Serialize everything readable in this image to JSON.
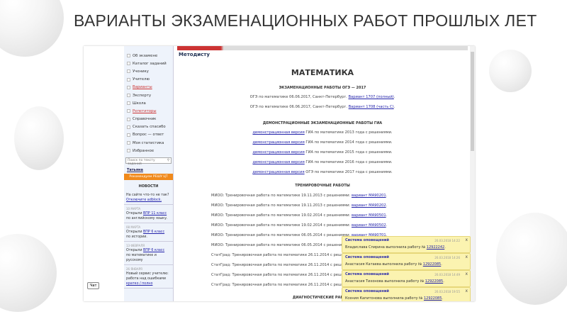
{
  "slide_title": "ВАРИАНТЫ ЭКЗАМЕНАЦИОННЫХ РАБОТ ПРОШЛЫХ ЛЕТ",
  "menu": [
    {
      "label": "Об экзамене"
    },
    {
      "label": "Каталог заданий"
    },
    {
      "label": "Ученику"
    },
    {
      "label": "Учителю"
    },
    {
      "label": "Варианты",
      "red": true
    },
    {
      "label": "Эксперту"
    },
    {
      "label": "Школа"
    },
    {
      "label": "Репетиторы",
      "red": true
    },
    {
      "label": "Справочник"
    },
    {
      "label": "Сказать спасибо"
    },
    {
      "label": "Вопрос — ответ"
    },
    {
      "label": "Моя статистика"
    },
    {
      "label": "Избранное"
    }
  ],
  "search_placeholder": "Поиск по тексту заданий",
  "user": "Татьяна",
  "recommend": "Рекомендуем РЕШУ ЦТ",
  "news": {
    "title": "НОВОСТИ",
    "items": [
      {
        "date": "",
        "text": "На сайте что-то не так?",
        "link": "Отключите adblock.",
        "rest": ""
      },
      {
        "date": "10 МАРТА",
        "text": "Открыли",
        "link": "ВПР 11 класс",
        "rest": "по английскому языку."
      },
      {
        "date": "08 МАРТА",
        "text": "Открыли",
        "link": "ВПР 6 класс",
        "rest": "по истории."
      },
      {
        "date": "13 ФЕВРАЛЯ",
        "text": "Открыли",
        "link": "ВПР 6 класс",
        "rest": "по математике и русскому"
      },
      {
        "date": "26 ЯНВАРЯ",
        "text": "Новый сервис учителю: работа над ошибками",
        "link": "кратко / полно",
        "rest": ""
      }
    ]
  },
  "chat": "Чат",
  "breadcrumb": "Методисту",
  "page_title": "МАТЕМАТИКА",
  "sections": {
    "oge": {
      "title": "ЭКЗАМЕНАЦИОННЫЕ РАБОТЫ ОГЭ — 2017",
      "rows": [
        {
          "text": "ОГЭ по математике 06.06.2017, Санкт-Петербург. ",
          "link": "Вариант 1707 (полный)",
          "end": "."
        },
        {
          "text": "ОГЭ по математике 06.06.2017, Санкт-Петербург. ",
          "link": "Вариант 1708 (часть С)",
          "end": "."
        }
      ]
    },
    "demo": {
      "title": "ДЕМОНСТРАЦИОННЫЕ ЭКЗАМЕНАЦИОННЫЕ РАБОТЫ ГИА",
      "rows": [
        {
          "link": "демонстрационная версия",
          "text": " ГИА по математике 2013 года с решениями."
        },
        {
          "link": "демонстрационная версия",
          "text": " ГИА по математике 2014 года с решениями."
        },
        {
          "link": "демонстрационная версия",
          "text": " ГИА по математике 2015 года с решениями."
        },
        {
          "link": "демонстрационная версия",
          "text": " ГИА по математике 2016 года с решениями."
        },
        {
          "link": "демонстрационная версия",
          "text": " ОГЭ по математике 2017 года с решениями."
        }
      ]
    },
    "training": {
      "title": "ТРЕНИРОВОЧНЫЕ РАБОТЫ",
      "rows": [
        {
          "text": "МИОО: Тренировочная работа по математике 19.11.2013 с решениями: ",
          "link": "вариант МА90201",
          "end": "."
        },
        {
          "text": "МИОО: Тренировочная работа по математике 19.11.2013 с решениями: ",
          "link": "вариант МА90202",
          "end": "."
        },
        {
          "text": "МИОО: Тренировочная работа по математике 19.02.2014 с решениями: ",
          "link": "вариант МА90501",
          "end": "."
        },
        {
          "text": "МИОО: Тренировочная работа по математике 19.02.2014 с решениями: ",
          "link": "вариант МА90502",
          "end": "."
        },
        {
          "text": "МИОО: Тренировочная работа по математике 06.05.2014 с решениями: ",
          "link": "вариант МА90701",
          "end": "."
        },
        {
          "text": "МИОО: Тренировочная работа по математике 06.05.2014 с решениями: ",
          "link": "",
          "end": ""
        },
        {
          "text": "СтатГрад: Тренировочная работа по математике 26.11.2014 с решениями: ",
          "link": "",
          "end": ""
        },
        {
          "text": "СтатГрад: Тренировочная работа по математике 26.11.2014 с решениями: ",
          "link": "",
          "end": ""
        },
        {
          "text": "СтатГрад: Тренировочная работа по математике 26.11.2014 с решениями: ",
          "link": "",
          "end": ""
        },
        {
          "text": "СтатГрад: Тренировочная работа по математике 26.11.2014 с решениями: ",
          "link": "",
          "end": ""
        }
      ]
    },
    "diag": {
      "title": "ДИАГНОСТИЧЕСКИЕ РАБОТЫ"
    }
  },
  "notifications": [
    {
      "title": "Система оповещений",
      "time": "26.03.2018 14:22",
      "text": "Владислава Спирина выполнила работу № ",
      "link": "12922242",
      "close": "x"
    },
    {
      "title": "Система оповещений",
      "time": "26.03.2018 14:26",
      "text": "Анастасия Катаева выполнила работу № ",
      "link": "12922085",
      "close": "x"
    },
    {
      "title": "Система оповещений",
      "time": "26.03.2018 14:49",
      "text": "Анастасия Тихонова выполнила работу № ",
      "link": "12922085",
      "close": "x"
    },
    {
      "title": "Система оповещений",
      "time": "26.03.2018 19:55",
      "text": "Ксения Капитонова выполнила работу № ",
      "link": "12922085",
      "close": "x"
    }
  ]
}
